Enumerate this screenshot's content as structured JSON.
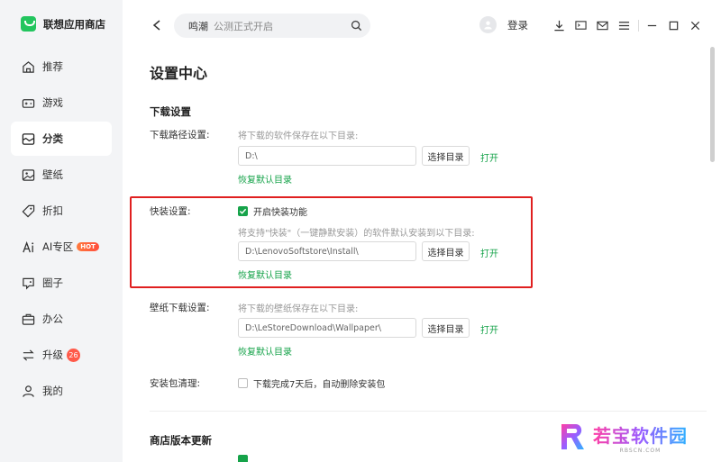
{
  "app": {
    "name": "联想应用商店"
  },
  "sidebar": {
    "items": [
      {
        "label": "推荐",
        "icon": "home-icon"
      },
      {
        "label": "游戏",
        "icon": "gamepad-icon"
      },
      {
        "label": "分类",
        "icon": "category-icon",
        "active": true
      },
      {
        "label": "壁纸",
        "icon": "image-icon"
      },
      {
        "label": "折扣",
        "icon": "tag-icon"
      },
      {
        "label": "AI专区",
        "icon": "ai-icon",
        "badge": "HOT"
      },
      {
        "label": "圈子",
        "icon": "chat-icon"
      },
      {
        "label": "办公",
        "icon": "briefcase-icon"
      },
      {
        "label": "升级",
        "icon": "swap-icon",
        "badge": "26"
      },
      {
        "label": "我的",
        "icon": "user-icon"
      }
    ]
  },
  "search": {
    "brand": "鸣潮",
    "hint": "公测正式开启"
  },
  "header": {
    "login": "登录"
  },
  "page": {
    "title": "设置中心"
  },
  "download": {
    "section_title": "下载设置",
    "path": {
      "label": "下载路径设置:",
      "hint": "将下载的软件保存在以下目录:",
      "value": "D:\\",
      "choose": "选择目录",
      "open": "打开",
      "restore": "恢复默认目录"
    },
    "quick": {
      "label": "快装设置:",
      "toggle_label": "开启快装功能",
      "toggle_checked": true,
      "hint": "将支持\"快装\"（一键静默安装）的软件默认安装到以下目录:",
      "value": "D:\\LenovoSoftstore\\Install\\",
      "choose": "选择目录",
      "open": "打开",
      "restore": "恢复默认目录"
    },
    "wallpaper": {
      "label": "壁纸下载设置:",
      "hint": "将下载的壁纸保存在以下目录:",
      "value": "D:\\LeStoreDownload\\Wallpaper\\",
      "choose": "选择目录",
      "open": "打开",
      "restore": "恢复默认目录"
    },
    "cleanup": {
      "label": "安装包清理:",
      "option": "下载完成7天后，自动删除安装包",
      "checked": false
    }
  },
  "update": {
    "section_title": "商店版本更新"
  },
  "watermark": {
    "main": "若宝软件园",
    "sub": "RBSCN.COM"
  },
  "colors": {
    "accent": "#16a34a",
    "highlight": "#e02020"
  }
}
